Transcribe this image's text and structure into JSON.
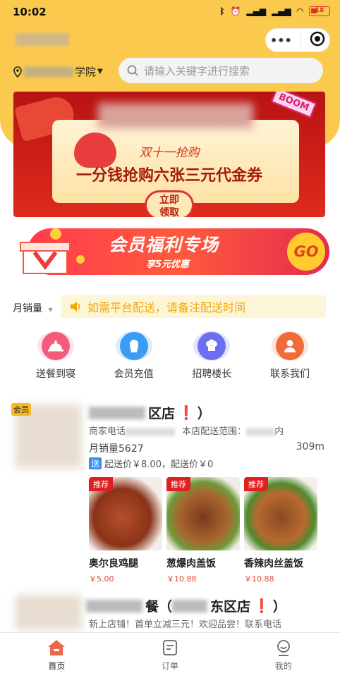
{
  "status_bar": {
    "time": "10:02",
    "icons": [
      "bluetooth-icon",
      "alarm-icon",
      "signal-hd1-icon",
      "signal-hd2-icon",
      "wifi-icon"
    ],
    "battery": "18"
  },
  "header": {
    "location_suffix": "学院",
    "search_placeholder": "请输入关键字进行搜索"
  },
  "banner1": {
    "subtitle": "双十一抢购",
    "title": "一分钱抢购六张三元代金券",
    "button": "立即\n领取",
    "boom": "BOOM"
  },
  "banner2": {
    "title": "会员福利专场",
    "subtitle": "享5元优惠",
    "go": "GO"
  },
  "sort_label": "月销量",
  "notice": "如需平台配送，请备注配送时间",
  "categories": [
    {
      "label": "送餐到寝",
      "icon": "food-cover-icon",
      "color": "#f25c7a"
    },
    {
      "label": "会员充值",
      "icon": "cupcake-icon",
      "color": "#3a9cf2"
    },
    {
      "label": "招聘楼长",
      "icon": "chef-hat-icon",
      "color": "#6b6ff2"
    },
    {
      "label": "联系我们",
      "icon": "person-icon",
      "color": "#f06a3a"
    }
  ],
  "stores": [
    {
      "member": "会员",
      "name_visible": "区店",
      "exclaim": "❗",
      "paren_close": "）",
      "phone_label": "商家电话",
      "range_label": "本店配送范围：",
      "range_suffix": "内",
      "distance": "309m",
      "sales": "月销量5627",
      "delivery_tag": "送",
      "delivery": "起送价￥8.00，配送价￥0",
      "dishes": [
        {
          "tag": "推荐",
          "name": "奥尔良鸡腿",
          "price": "￥5.00"
        },
        {
          "tag": "推荐",
          "name": "葱爆肉盖饭",
          "price": "￥10.88"
        },
        {
          "tag": "推荐",
          "name": "香辣肉丝盖饭",
          "price": "￥10.88"
        }
      ]
    },
    {
      "name_visible": "餐（",
      "name_visible2": "东区店",
      "exclaim": "❗",
      "paren_close": "）",
      "intro": "新上店铺！首单立减三元！欢迎品尝！联系电话"
    }
  ],
  "tabbar": [
    {
      "label": "首页",
      "icon": "home-icon",
      "active": true
    },
    {
      "label": "订单",
      "icon": "order-icon",
      "active": false
    },
    {
      "label": "我的",
      "icon": "profile-icon",
      "active": false
    }
  ]
}
